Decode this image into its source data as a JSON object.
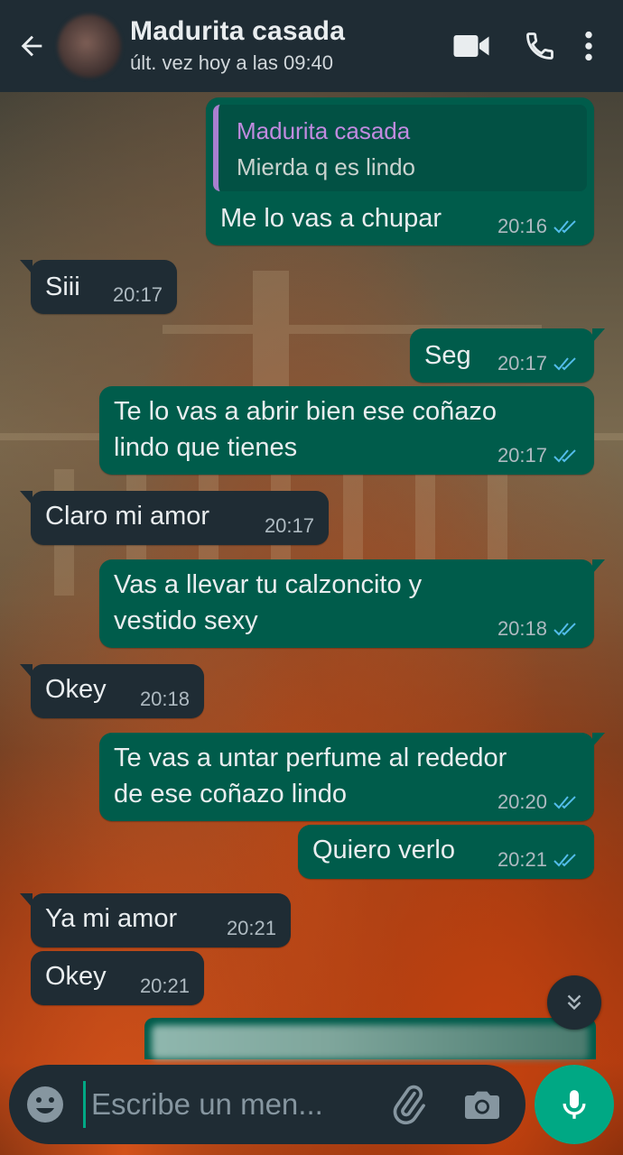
{
  "header": {
    "contact_name": "Madurita casada",
    "last_seen": "últ. vez hoy a las 09:40"
  },
  "quote": {
    "author": "Madurita casada",
    "text": "Mierda q es lindo"
  },
  "messages": [
    {
      "dir": "out",
      "lines": [
        "Me lo vas a chupar"
      ],
      "time": "20:16"
    },
    {
      "dir": "in",
      "lines": [
        "Siii"
      ],
      "time": "20:17"
    },
    {
      "dir": "out",
      "lines": [
        "Seg"
      ],
      "time": "20:17"
    },
    {
      "dir": "out",
      "lines": [
        "Te lo vas a abrir bien ese coñazo",
        "lindo que tienes"
      ],
      "time": "20:17"
    },
    {
      "dir": "in",
      "lines": [
        "Claro mi amor"
      ],
      "time": "20:17"
    },
    {
      "dir": "out",
      "lines": [
        "Vas a llevar tu calzoncito y",
        "vestido sexy"
      ],
      "time": "20:18"
    },
    {
      "dir": "in",
      "lines": [
        "Okey"
      ],
      "time": "20:18"
    },
    {
      "dir": "out",
      "lines": [
        "Te vas a untar perfume al rededor",
        "de ese coñazo lindo"
      ],
      "time": "20:20"
    },
    {
      "dir": "out",
      "lines": [
        "Quiero verlo"
      ],
      "time": "20:21"
    },
    {
      "dir": "in",
      "lines": [
        "Ya mi amor"
      ],
      "time": "20:21"
    },
    {
      "dir": "in",
      "lines": [
        "Okey"
      ],
      "time": "20:21"
    }
  ],
  "composer": {
    "placeholder": "Escribe un men..."
  },
  "icons": {
    "back": "arrow-left-icon",
    "video": "video-call-icon",
    "call": "phone-icon",
    "menu": "more-vertical-icon",
    "emoji": "emoji-icon",
    "attach": "paperclip-icon",
    "camera": "camera-icon",
    "mic": "microphone-icon",
    "scroll": "double-chevron-down-icon",
    "read_status": "double-check-icon"
  },
  "colors": {
    "header_bg": "#1f2c34",
    "outgoing_bubble": "#005c4b",
    "incoming_bubble": "#1f2c34",
    "accent": "#00a884",
    "read_ticks": "#53bdeb",
    "quote_author": "#c18be0"
  }
}
